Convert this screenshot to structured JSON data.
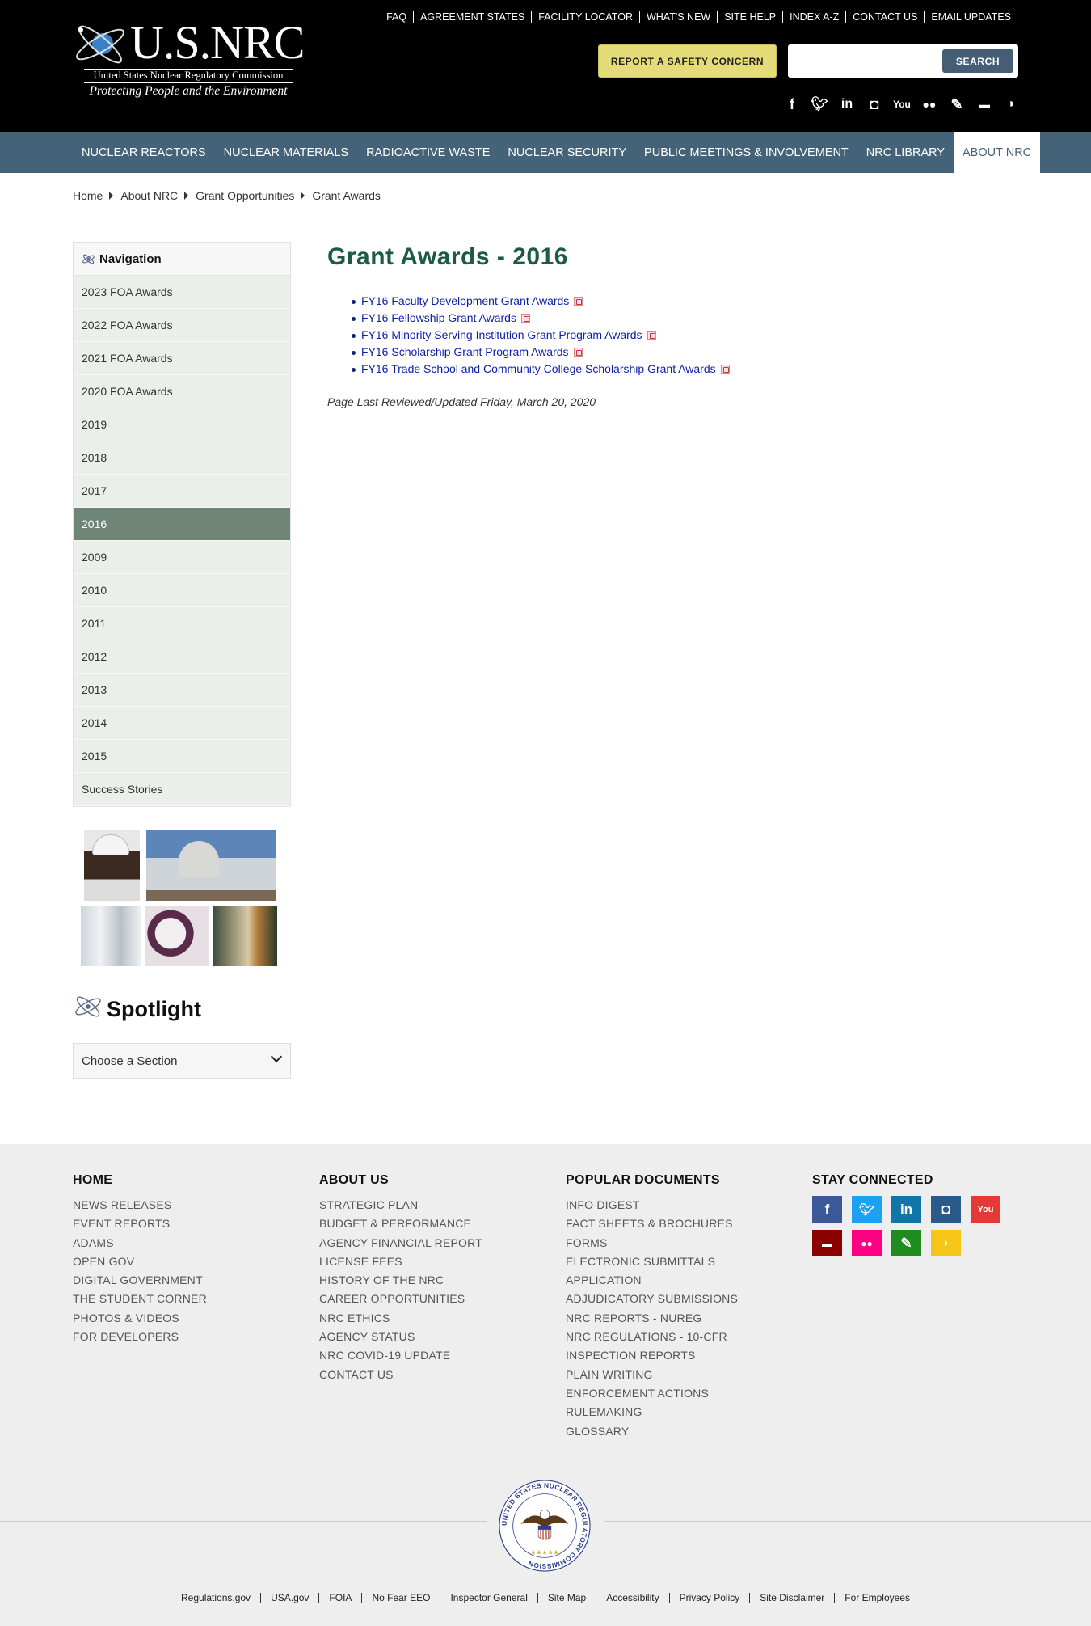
{
  "logo": {
    "wordmark": "U.S.NRC",
    "full_name": "United States Nuclear Regulatory Commission",
    "tagline": "Protecting People and the Environment"
  },
  "utility_nav": [
    "FAQ",
    "AGREEMENT STATES",
    "FACILITY LOCATOR",
    "WHAT'S NEW",
    "SITE HELP",
    "INDEX A-Z",
    "CONTACT US",
    "EMAIL UPDATES"
  ],
  "header": {
    "report_label": "REPORT A SAFETY CONCERN",
    "search_value": "",
    "search_button": "SEARCH",
    "social_icons": [
      "facebook-icon",
      "twitter-icon",
      "linkedin-icon",
      "instagram-icon",
      "youtube-icon",
      "flickr-icon",
      "blog-icon",
      "comment-icon",
      "rss-icon"
    ]
  },
  "main_nav": [
    {
      "label": "NUCLEAR REACTORS",
      "active": false
    },
    {
      "label": "NUCLEAR MATERIALS",
      "active": false
    },
    {
      "label": "RADIOACTIVE WASTE",
      "active": false
    },
    {
      "label": "NUCLEAR SECURITY",
      "active": false
    },
    {
      "label": "PUBLIC MEETINGS & INVOLVEMENT",
      "active": false
    },
    {
      "label": "NRC LIBRARY",
      "active": false
    },
    {
      "label": "ABOUT NRC",
      "active": true
    }
  ],
  "breadcrumb": [
    "Home",
    "About NRC",
    "Grant Opportunities",
    "Grant Awards"
  ],
  "sidebar": {
    "heading": "Navigation",
    "items": [
      "2023 FOA Awards",
      "2022 FOA Awards",
      "2021 FOA Awards",
      "2020 FOA Awards",
      "2019",
      "2018",
      "2017",
      "2016",
      "2009",
      "2010",
      "2011",
      "2012",
      "2013",
      "2014",
      "2015",
      "Success Stories"
    ],
    "active_item": "2016",
    "spotlight_title": "Spotlight",
    "select_value": "Choose a Section"
  },
  "main": {
    "title": "Grant Awards - 2016",
    "awards": [
      "FY16 Faculty Development Grant Awards",
      "FY16 Fellowship Grant Awards",
      "FY16 Minority Serving Institution Grant Program Awards",
      "FY16 Scholarship Grant Program Awards",
      "FY16 Trade School and Community College Scholarship Grant Awards"
    ],
    "last_reviewed": "Page Last Reviewed/Updated Friday, March 20, 2020"
  },
  "footer": {
    "columns": [
      {
        "heading": "HOME",
        "links": [
          "NEWS RELEASES",
          "EVENT REPORTS",
          "ADAMS",
          "OPEN GOV",
          "DIGITAL GOVERNMENT",
          "THE STUDENT CORNER",
          "PHOTOS & VIDEOS",
          "FOR DEVELOPERS"
        ]
      },
      {
        "heading": "ABOUT US",
        "links": [
          "STRATEGIC PLAN",
          "BUDGET & PERFORMANCE",
          "AGENCY FINANCIAL REPORT",
          "LICENSE FEES",
          "HISTORY OF THE NRC",
          "CAREER OPPORTUNITIES",
          "NRC ETHICS",
          "AGENCY STATUS",
          "NRC COVID-19 UPDATE",
          "CONTACT US"
        ]
      },
      {
        "heading": "POPULAR DOCUMENTS",
        "links": [
          "INFO DIGEST",
          "FACT SHEETS & BROCHURES",
          "FORMS",
          "ELECTRONIC SUBMITTALS",
          "APPLICATION",
          "ADJUDICATORY SUBMISSIONS",
          "NRC REPORTS - NUREG",
          "NRC REGULATIONS - 10-CFR",
          "INSPECTION REPORTS",
          "PLAIN WRITING",
          "ENFORCEMENT ACTIONS",
          "RULEMAKING",
          "GLOSSARY"
        ]
      },
      {
        "heading": "STAY CONNECTED",
        "links": []
      }
    ],
    "social": [
      {
        "icon": "facebook-icon",
        "glyph": "f",
        "color": "#3b5998"
      },
      {
        "icon": "twitter-icon",
        "glyph": "t",
        "color": "#1da1f2"
      },
      {
        "icon": "linkedin-icon",
        "glyph": "in",
        "color": "#0e76a8"
      },
      {
        "icon": "instagram-icon",
        "glyph": "◘",
        "color": "#2a5a8a"
      },
      {
        "icon": "youtube-icon",
        "glyph": "▶",
        "color": "#e53935"
      },
      {
        "icon": "comment-icon",
        "glyph": "▬",
        "color": "#8b0000"
      },
      {
        "icon": "flickr-icon",
        "glyph": "••",
        "color": "#ff0084"
      },
      {
        "icon": "blog-icon",
        "glyph": "✎",
        "color": "#1e8c1e"
      },
      {
        "icon": "rss-icon",
        "glyph": "◉",
        "color": "#f5c518"
      }
    ],
    "seal_text": "UNITED STATES NUCLEAR REGULATORY COMMISSION",
    "bottom_links": [
      "Regulations.gov",
      "USA.gov",
      "FOIA",
      "No Fear EEO",
      "Inspector General",
      "Site Map",
      "Accessibility",
      "Privacy Policy",
      "Site Disclaimer",
      "For Employees"
    ]
  }
}
